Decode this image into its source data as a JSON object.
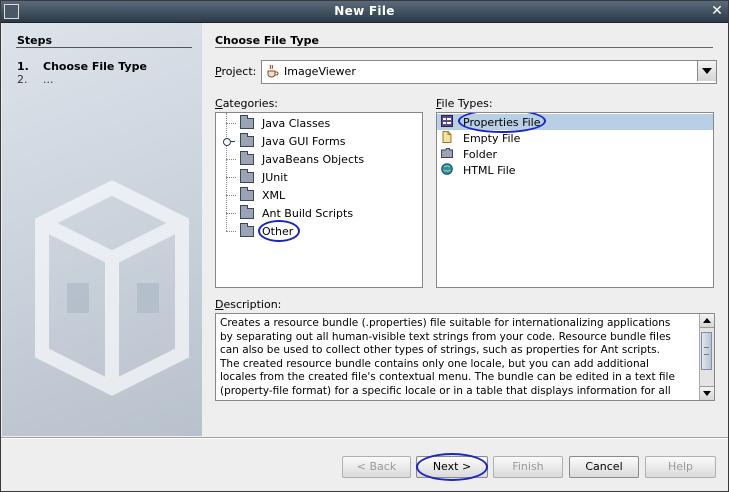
{
  "window": {
    "title": "New File"
  },
  "steps": {
    "title": "Steps",
    "items": [
      {
        "num": "1.",
        "label": "Choose File Type"
      },
      {
        "num": "2.",
        "label": "..."
      }
    ]
  },
  "main": {
    "section_title": "Choose File Type",
    "project": {
      "label": "Project:",
      "mnemonic": "P",
      "rest": "roject:",
      "value": "ImageViewer"
    },
    "categories": {
      "label": "Categories:",
      "mnemonic": "C",
      "rest": "ategories:",
      "items": [
        "Java Classes",
        "Java GUI Forms",
        "JavaBeans Objects",
        "JUnit",
        "XML",
        "Ant Build Scripts",
        "Other"
      ]
    },
    "file_types": {
      "label": "File Types:",
      "mnemonic": "F",
      "rest": "ile Types:",
      "items": [
        "Properties File",
        "Empty File",
        "Folder",
        "HTML File"
      ]
    },
    "description": {
      "label": "Description:",
      "mnemonic": "D",
      "rest": "escription:",
      "text": "Creates a resource bundle (.properties) file suitable for internationalizing applications\nby separating out all human-visible text strings from your code. Resource bundle files\ncan also be used to collect other types of strings, such as properties for Ant scripts.\nThe created resource bundle contains only one locale, but you can add additional\nlocales from the created file's contextual menu. The bundle can be edited in a text file\n(property-file format) for a specific locale or in a table that displays information for all"
    }
  },
  "buttons": {
    "back": "< Back",
    "next": "Next >",
    "finish": "Finish",
    "cancel": "Cancel",
    "help": "Help"
  },
  "colors": {
    "annotation": "#1a24c8",
    "selection": "#b8cfe5",
    "titlebar": "#2c3a48"
  }
}
